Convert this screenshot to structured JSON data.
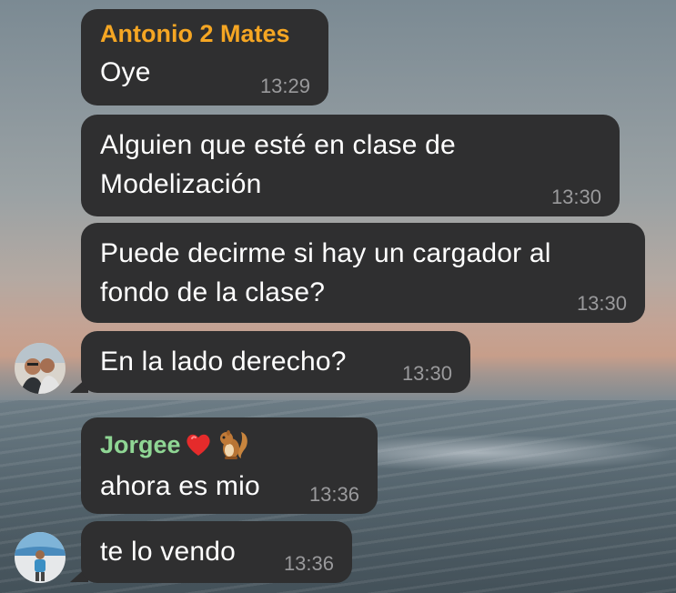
{
  "messages": [
    {
      "sender": "Antonio 2 Mates",
      "text": "Oye",
      "time": "13:29"
    },
    {
      "text_line1": "Alguien que esté en clase de",
      "text_line2": "Modelización",
      "time": "13:30"
    },
    {
      "text_line1": "Puede decirme si hay un cargador al",
      "text_line2": "fondo de la clase?",
      "time": "13:30"
    },
    {
      "text": "En la lado derecho?",
      "time": "13:30"
    },
    {
      "sender": "Jorgee",
      "sender_emojis": [
        "red-heart",
        "chipmunk"
      ],
      "text": "ahora es mio",
      "time": "13:36"
    },
    {
      "text": "te lo vendo",
      "time": "13:36"
    }
  ],
  "colors": {
    "bubble": "#2f2f30",
    "antonio_name": "#f5a623",
    "jorgee_name": "#8fd694",
    "timestamp": "#9a9a9c"
  }
}
